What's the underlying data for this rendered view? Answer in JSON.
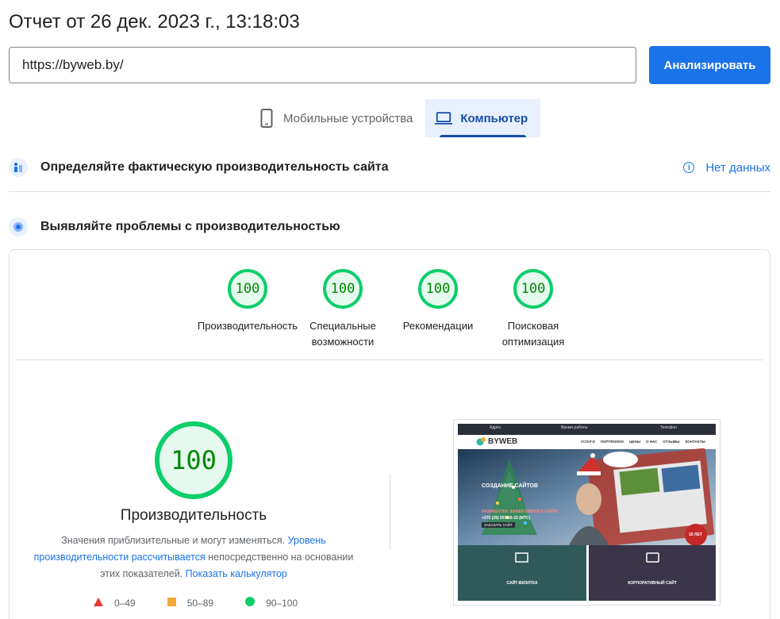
{
  "report": {
    "title": "Отчет от 26 дек. 2023 г., 13:18:03"
  },
  "search": {
    "url": "https://byweb.by/",
    "analyze_label": "Анализировать"
  },
  "tabs": [
    {
      "label": "Мобильные устройства",
      "icon": "phone-icon"
    },
    {
      "label": "Компьютер",
      "icon": "laptop-icon"
    }
  ],
  "section_real": {
    "label": "Определяйте фактическую производительность сайта",
    "no_data": "Нет данных",
    "info_glyph": "i"
  },
  "section_diag": {
    "label": "Выявляйте проблемы с производительностью"
  },
  "scores": [
    {
      "value": "100",
      "label_line1": "Производительность",
      "label_line2": ""
    },
    {
      "value": "100",
      "label_line1": "Специальные",
      "label_line2": "возможности"
    },
    {
      "value": "100",
      "label_line1": "Рекомендации",
      "label_line2": ""
    },
    {
      "value": "100",
      "label_line1": "Поисковая",
      "label_line2": "оптимизация"
    }
  ],
  "performance": {
    "value": "100",
    "title": "Производительность",
    "desc_1": "Значения приблизительные и могут изменяться. ",
    "desc_link_1": "Уровень производительности рассчитывается",
    "desc_2": " непосредственно на основании этих показателей. ",
    "desc_link_2": "Показать калькулятор"
  },
  "legend": [
    {
      "label": "0–49",
      "color": "#e53935"
    },
    {
      "label": "50–89",
      "color": "#f4a93b"
    },
    {
      "label": "90–100",
      "color": "#0cce6b"
    }
  ],
  "colors": {
    "accent": "#1a73e8",
    "pass": "#0cce6b",
    "pass_text": "#008800"
  },
  "thumbnail": {
    "top_bar_1": "Адрес",
    "top_bar_2": "Время работы",
    "top_bar_3": "Телефон",
    "logo": "BYWEB",
    "nav": [
      "УСЛУГИ",
      "ПОРТФОЛИО",
      "ЦЕНЫ",
      "О НАС",
      "ОТЗЫВЫ",
      "КОНТАКТЫ"
    ],
    "hero_title": "СОЗДАНИЕ САЙТОВ",
    "hero_sub": "РАЗРАБОТКА ЭФФЕКТИВНОГО САЙТА",
    "hero_phone": "+375 (29) 557-26-33 (МТС)",
    "hero_btn": "ЗАКАЗАТЬ САЙТ",
    "badge": "10 ЛЕТ",
    "card_1": "САЙТ-ВИЗИТКА",
    "card_2": "КОРПОРАТИВНЫЙ САЙТ"
  }
}
